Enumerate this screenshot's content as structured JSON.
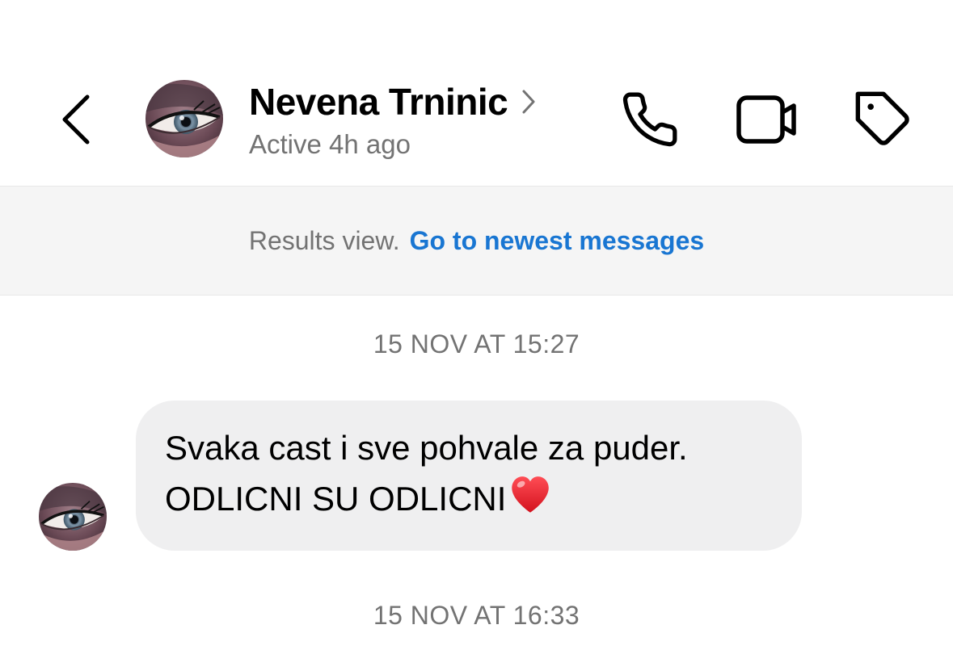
{
  "header": {
    "contact_name": "Nevena Trninic",
    "status": "Active 4h ago",
    "icons": [
      "chevron-left-icon",
      "chevron-right-icon",
      "phone-icon",
      "video-icon",
      "tag-icon"
    ]
  },
  "banner": {
    "prefix": "Results view.",
    "link": "Go to newest messages"
  },
  "thread": {
    "timestamp_1": "15 NOV AT 15:27",
    "message": {
      "line_1": "Svaka cast i sve pohvale za puder.",
      "line_2": "ODLICNI SU ODLICNI",
      "emoji": "heart-emoji"
    },
    "timestamp_2": "15 NOV AT 16:33"
  },
  "colors": {
    "link": "#1976d2",
    "muted": "#737373",
    "bubble": "#efeff0",
    "banner_bg": "#f5f5f5",
    "heart": "#e8202c"
  }
}
